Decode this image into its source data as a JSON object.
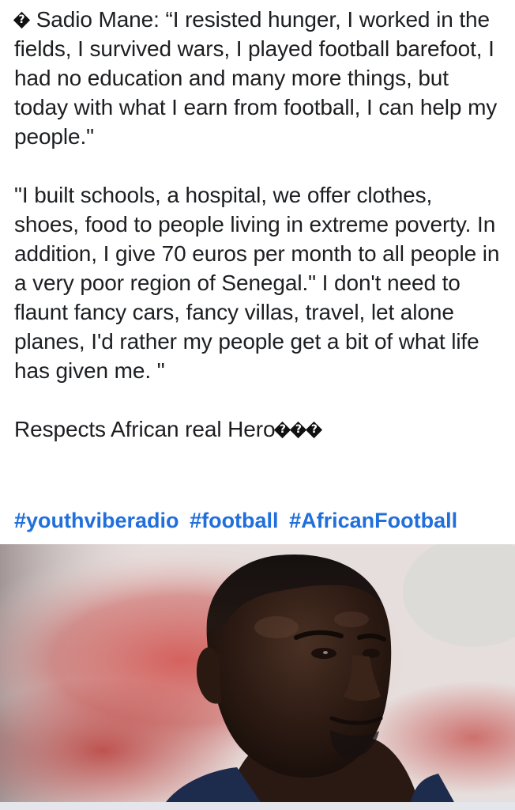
{
  "post": {
    "paragraphs": [
      {
        "prefix_glyph": "unknown-character-icon",
        "text": "Sadio Mane: “I resisted hunger, I worked in the fields, I survived wars, I played football barefoot, I had no education and many more things, but today with what I earn from football, I can help my people.\""
      },
      {
        "text": "\"I built schools, a hospital, we offer clothes, shoes, food to people living in extreme poverty. In addition, I give 70 euros per month to all people in a very poor region of Senegal.\" I don't need to flaunt fancy cars, fancy villas, travel, let alone planes, I'd rather my people get a bit of what life has given me. \""
      }
    ],
    "closing_text": "Respects African real Hero",
    "closing_glyph_count": 3,
    "hashtags": [
      "#youthviberadio",
      "#football",
      "#AfricanFootball"
    ],
    "photo": {
      "subject": "Sadio Mane portrait",
      "colors": {
        "background_light": "#e9e3e2",
        "background_red": "#c84a47",
        "skin_dark": "#2b1a12",
        "shirt_navy": "#1d2b4d"
      }
    },
    "colors": {
      "text": "#1c1e21",
      "hashtag": "#216fdb",
      "background": "#ffffff"
    }
  }
}
